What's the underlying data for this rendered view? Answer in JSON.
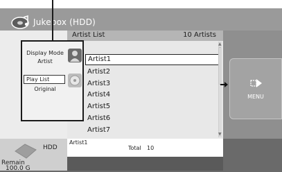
{
  "header": {
    "title": "Jukebox (HDD)"
  },
  "list": {
    "column_label": "Artist List",
    "count_label": "10 Artists",
    "items": [
      "Artist1",
      "Artist2",
      "Artist3",
      "Artist4",
      "Artist5",
      "Artist6",
      "Artist7"
    ]
  },
  "overlay": {
    "display_mode_label": "Display Mode",
    "display_mode_value": "Artist",
    "play_list_label": "Play List",
    "play_list_value": "Original"
  },
  "menu": {
    "label": "MENU"
  },
  "footer": {
    "drive": "HDD",
    "remain_label": "Remain",
    "remain_value": "100.0 G",
    "selected_artist": "Artist1",
    "total_label": "Total",
    "total_value": "10"
  },
  "colors": {
    "selection_border": "#222222",
    "header_bg": "#9a9a9a",
    "panel_bg": "#ececec"
  }
}
